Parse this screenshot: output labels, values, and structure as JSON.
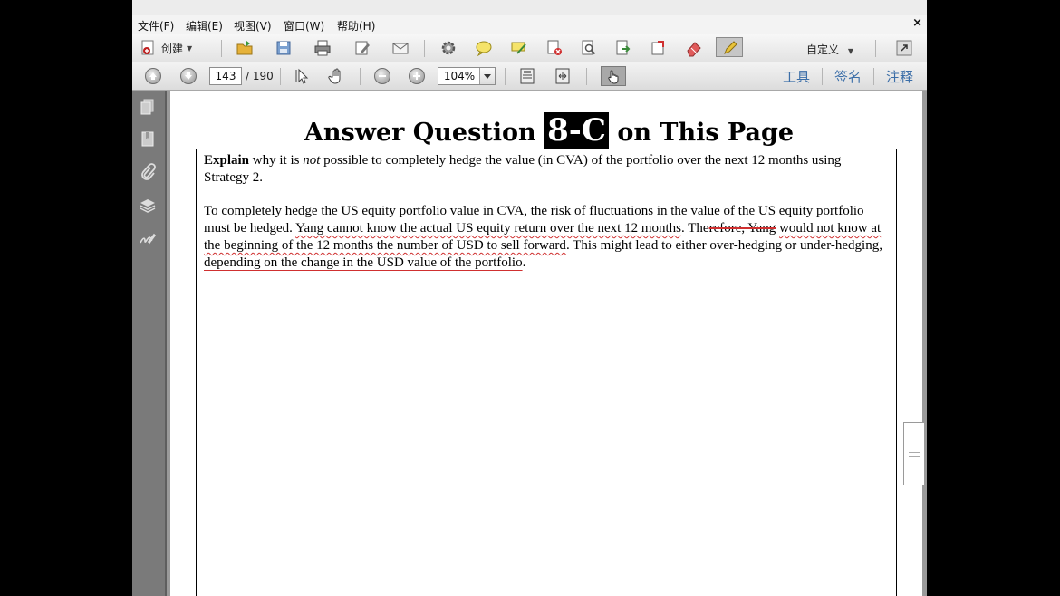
{
  "menu": {
    "file": "文件(F)",
    "edit": "编辑(E)",
    "view": "视图(V)",
    "window": "窗口(W)",
    "help": "帮助(H)"
  },
  "toolbar": {
    "create_label": "创建",
    "custom_label": "自定义"
  },
  "nav": {
    "current_page": "143",
    "total_pages": "/ 190",
    "zoom": "104%"
  },
  "right_tabs": {
    "tools": "工具",
    "sign": "签名",
    "comment": "注释"
  },
  "document": {
    "heading_prefix": "Answer Question",
    "heading_badge": "8-C",
    "heading_suffix": "on This Page",
    "q_bold": "Explain",
    "q_part1": "why it is",
    "q_italic": "not",
    "q_part2": "possible to completely hedge the value (in CVA) of the portfolio over the next 12 months using Strategy 2.",
    "a_part1": "To completely hedge the US equity portfolio value in CVA, the risk of fluctuations in the value of the US equity portfolio must be hedged.",
    "a_hl1": "Yang cannot know the actual US equity return over the next 12 months",
    "a_part2": ". The",
    "a_hl2": "refore, Yang",
    "a_hl3": "would not know at the beginning of the 12 months the number of USD to sell forward",
    "a_part3": ". This might lead to either over-hedging or under-hedging,",
    "a_hl4": "depending on the change in the USD value of the portfolio",
    "a_part4": "."
  },
  "colors": {
    "annotation_red": "#d03030",
    "link_blue": "#3b6ea8"
  }
}
